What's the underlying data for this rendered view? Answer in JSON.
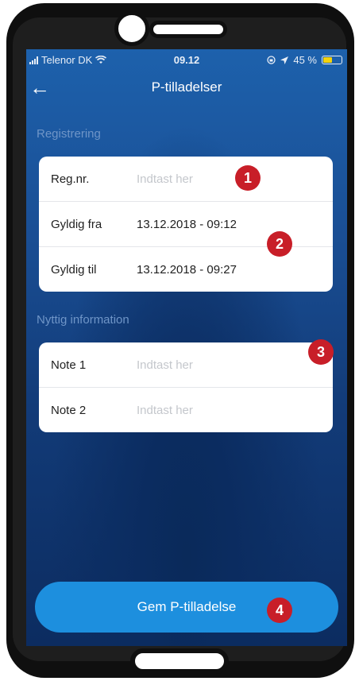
{
  "status_bar": {
    "carrier": "Telenor DK",
    "time": "09.12",
    "battery": "45 %"
  },
  "nav": {
    "title": "P-tilladelser"
  },
  "registration": {
    "section_title": "Registrering",
    "rows": [
      {
        "label": "Reg.nr.",
        "value": "Indtast her"
      },
      {
        "label": "Gyldig fra",
        "value": "13.12.2018 - 09:12"
      },
      {
        "label": "Gyldig til",
        "value": "13.12.2018 - 09:27"
      }
    ]
  },
  "info": {
    "section_title": "Nyttig information",
    "rows": [
      {
        "label": "Note 1",
        "value": "Indtast her"
      },
      {
        "label": "Note 2",
        "value": "Indtast her"
      }
    ]
  },
  "badges": [
    "1",
    "2",
    "3",
    "4"
  ],
  "save_button": {
    "label": "Gem P-tilladelse"
  },
  "colors": {
    "accent": "#1d8fde",
    "badge": "#c81e28",
    "placeholder": "#c4c7cc",
    "section_title": "#6f95c7"
  }
}
